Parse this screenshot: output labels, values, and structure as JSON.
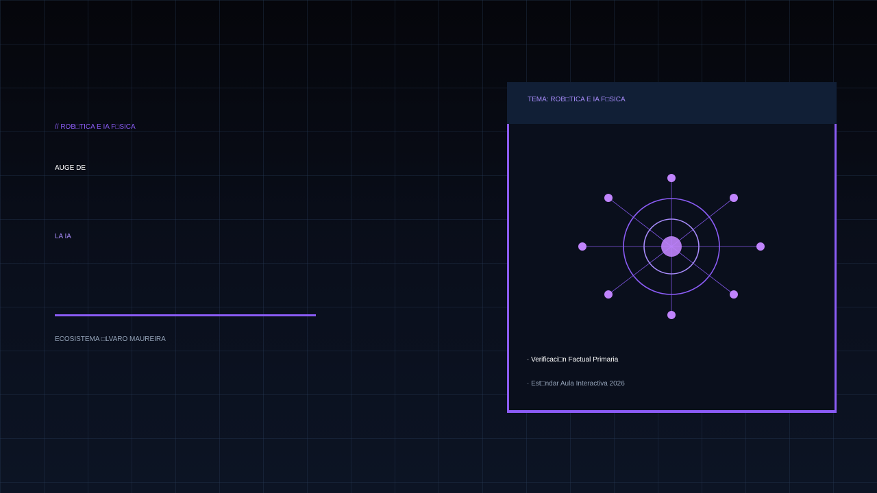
{
  "left": {
    "kicker": "// ROB□TICA E IA F□SICA",
    "title_line1": "AUGE DE",
    "title_line2": "LA IA",
    "footer": "ECOSISTEMA □LVARO MAUREIRA"
  },
  "card": {
    "topic": "TEMA: ROB□TICA E IA F□SICA",
    "graphic": "network-hub-icon",
    "bullets": [
      "· Verificaci□n Factual Primaria",
      "· Est□ndar Aula Interactiva 2026"
    ]
  },
  "colors": {
    "accent": "#8b5cf6",
    "accent_light": "#a78bfa",
    "node": "#c084fc",
    "card_bg": "#0a0f1c",
    "card_header_bg": "#111f36",
    "muted_text": "#94a3b8"
  }
}
